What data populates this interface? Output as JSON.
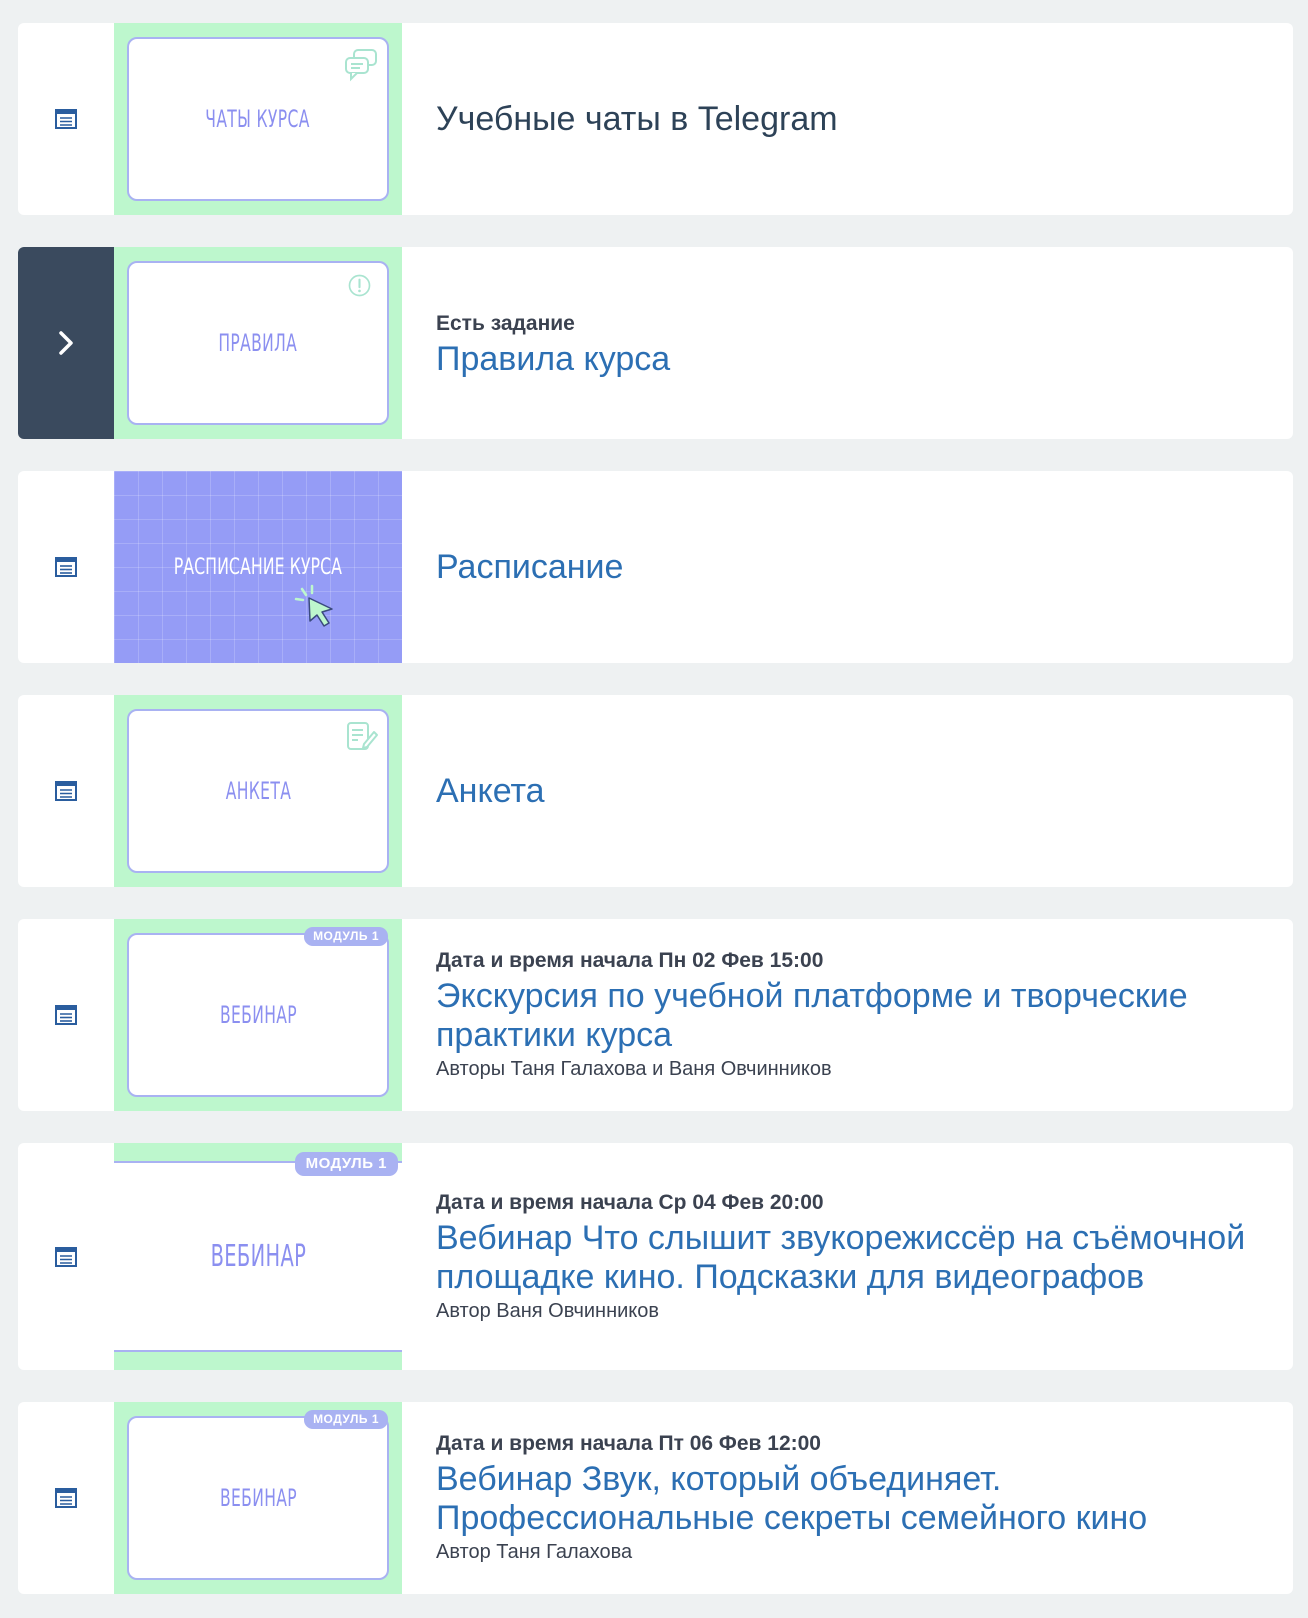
{
  "lessons": [
    {
      "thumb_title": "ЧАТЫ КУРСА",
      "thumb_icon": "chat-bubbles-icon",
      "meta": "",
      "title": "Учебные чаты в Telegram",
      "author": ""
    },
    {
      "thumb_title": "ПРАВИЛА",
      "thumb_icon": "exclamation-circle-icon",
      "meta": "Есть задание",
      "title": "Правила курса",
      "author": ""
    },
    {
      "thumb_title": "РАСПИСАНИЕ КУРСА",
      "thumb_icon": "cursor-click-icon",
      "meta": "",
      "title": "Расписание",
      "author": ""
    },
    {
      "thumb_title": "АНКЕТА",
      "thumb_icon": "edit-document-icon",
      "meta": "",
      "title": "Анкета",
      "author": ""
    },
    {
      "thumb_title": "ВЕБИНАР",
      "badge": "МОДУЛЬ 1",
      "meta": "Дата и время начала Пн 02 Фев 15:00",
      "title": "Экскурсия по учебной платформе и творческие практики курса",
      "author": "Авторы Таня Галахова и Ваня Овчинников"
    },
    {
      "thumb_title": "ВЕБИНАР",
      "badge": "МОДУЛЬ 1",
      "meta": "Дата и время начала Ср 04 Фев 20:00",
      "title": "Вебинар Что слышит звукорежиссёр на съёмочной площадке кино. Подсказки для видеографов",
      "author": "Автор Ваня Овчинников"
    },
    {
      "thumb_title": "ВЕБИНАР",
      "badge": "МОДУЛЬ 1",
      "meta": "Дата и время начала Пт 06 Фев 12:00",
      "title": "Вебинар Звук, который объединяет. Профессиональные секреты семейного кино",
      "author": "Автор Таня Галахова"
    }
  ],
  "side_icons": {
    "list": "list-document-icon",
    "active": "chevron-right-icon"
  },
  "colors": {
    "page_bg": "#eef1f2",
    "thumb_green": "#bdf7cd",
    "thumb_purple": "#959cf6",
    "accent_blue": "#2c6fb3",
    "active_side": "#3a4a5e"
  }
}
